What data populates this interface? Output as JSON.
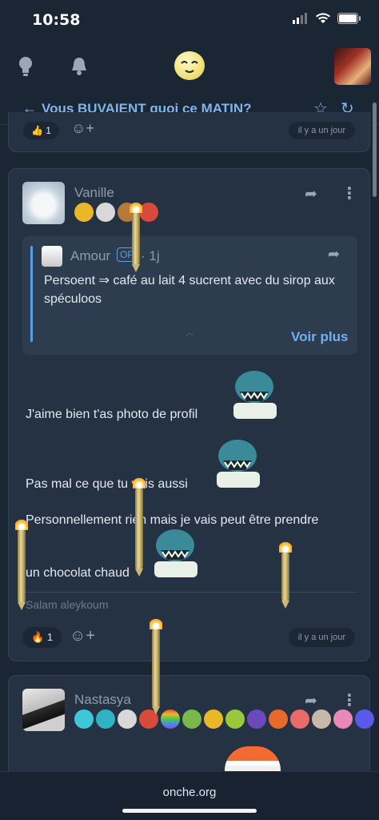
{
  "status_bar": {
    "time": "10:58"
  },
  "app_bar": {
    "icons": [
      "lightbulb-icon",
      "bell-icon",
      "onche-logo",
      "user-avatar"
    ]
  },
  "topic": {
    "back_icon": "←",
    "title": "Vous BUVAIENT quoi ce MATIN?",
    "star_icon": "☆",
    "refresh_icon": "↻"
  },
  "prev_post": {
    "reaction_emoji": "👍",
    "reaction_count": "1",
    "add_reaction_icon": "☺+",
    "time": "il y a un jour"
  },
  "post": {
    "author": "Vanille",
    "share_icon": "➦",
    "more_icon": "⋮",
    "badge_colors": [
      "#e8b829",
      "#d8d8d8",
      "#b87a3a",
      "#d84a3a"
    ],
    "quote": {
      "author": "Amour",
      "op_label": "OP",
      "sep": "·",
      "time": "1j",
      "text": "Persoent ⇒ café au lait 4 sucrent avec du sirop aux spéculoos",
      "fold_icon": "︿",
      "see_more": "Voir plus"
    },
    "lines": [
      "J'aime bien t'as photo de profil",
      "Pas mal ce que tu vois aussi",
      "Personnellement rien mais je vais peut être prendre",
      "un chocolat chaud"
    ],
    "signature": "Salam aleykoum",
    "reaction_emoji": "🔥",
    "reaction_count": "1",
    "add_reaction_icon": "☺+",
    "time": "il y a un jour"
  },
  "post2": {
    "author": "Nastasya",
    "share_icon": "➦",
    "more_icon": "⋮",
    "badge_colors": [
      "#3cc8d8",
      "#2fb3c4",
      "#d8d8d8",
      "#d84a3a",
      "#e05aa0",
      "#7ab84a",
      "#e8b829",
      "#9ac83a",
      "#6a4ab8",
      "#e86a2a",
      "#e86a6a",
      "#c8b8a8",
      "#e88ab8",
      "#5a5ae8"
    ]
  },
  "browser": {
    "url": "onche.org"
  }
}
